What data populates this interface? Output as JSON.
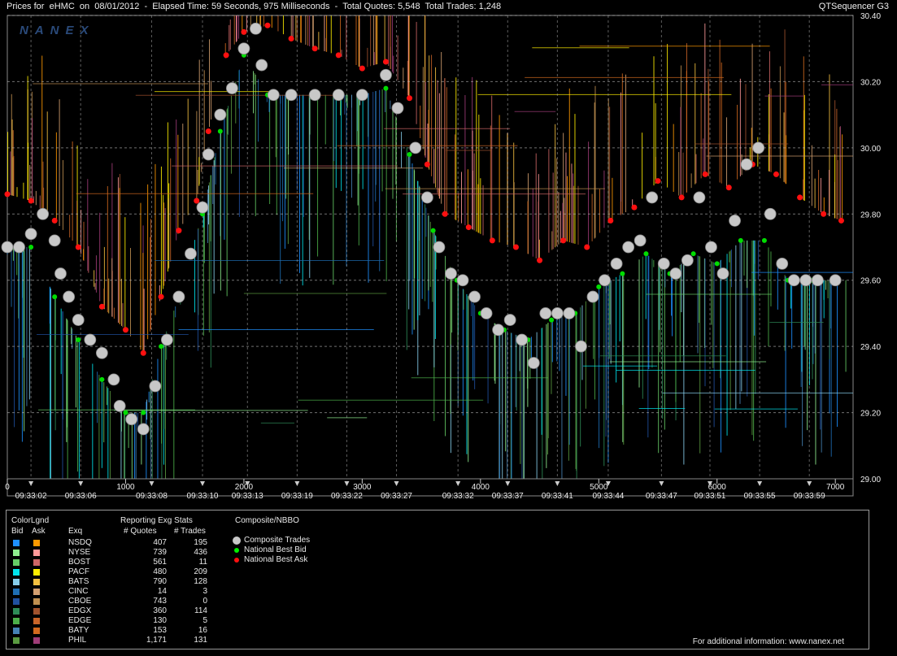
{
  "header": {
    "prefix": "Prices for",
    "symbol": "eHMC",
    "on_label": "on",
    "date": "08/01/2012",
    "elapsed": "Elapsed Time: 59 Seconds, 975 Milliseconds",
    "quotes": "Total Quotes: 5,548",
    "trades": "Total Trades: 1,248",
    "app": "QTSequencer G3"
  },
  "watermark": "NANEX",
  "chart_data": {
    "type": "scatter",
    "title": "Prices for eHMC on 08/01/2012",
    "xlim": [
      0,
      7150
    ],
    "ylim": [
      29.0,
      30.4
    ],
    "y_ticks": [
      "29.00",
      "29.20",
      "29.40",
      "29.60",
      "29.80",
      "30.00",
      "30.20",
      "30.40"
    ],
    "x_ticks": [
      "0",
      "1000",
      "2000",
      "3000",
      "4000",
      "5000",
      "6000",
      "7000"
    ],
    "time_labels": [
      {
        "x": 200,
        "t": "09:33:02"
      },
      {
        "x": 620,
        "t": "09:33:06"
      },
      {
        "x": 1220,
        "t": "09:33:08"
      },
      {
        "x": 1650,
        "t": "09:33:10"
      },
      {
        "x": 2030,
        "t": "09:33:13"
      },
      {
        "x": 2450,
        "t": "09:33:19"
      },
      {
        "x": 2870,
        "t": "09:33:22"
      },
      {
        "x": 3290,
        "t": "09:33:27"
      },
      {
        "x": 3810,
        "t": "09:33:32"
      },
      {
        "x": 4230,
        "t": "09:33:37"
      },
      {
        "x": 4650,
        "t": "09:33:41"
      },
      {
        "x": 5080,
        "t": "09:33:44"
      },
      {
        "x": 5530,
        "t": "09:33:47"
      },
      {
        "x": 5940,
        "t": "09:33:51"
      },
      {
        "x": 6360,
        "t": "09:33:55"
      },
      {
        "x": 6780,
        "t": "09:33:59"
      }
    ],
    "series": [
      {
        "name": "Composite Trades",
        "color": "#c8c8c8",
        "values": [
          [
            0,
            29.7
          ],
          [
            100,
            29.7
          ],
          [
            200,
            29.74
          ],
          [
            300,
            29.8
          ],
          [
            400,
            29.72
          ],
          [
            450,
            29.62
          ],
          [
            520,
            29.55
          ],
          [
            600,
            29.48
          ],
          [
            700,
            29.42
          ],
          [
            800,
            29.38
          ],
          [
            900,
            29.3
          ],
          [
            950,
            29.22
          ],
          [
            1050,
            29.18
          ],
          [
            1150,
            29.15
          ],
          [
            1250,
            29.28
          ],
          [
            1350,
            29.42
          ],
          [
            1450,
            29.55
          ],
          [
            1550,
            29.68
          ],
          [
            1650,
            29.82
          ],
          [
            1700,
            29.98
          ],
          [
            1800,
            30.1
          ],
          [
            1900,
            30.18
          ],
          [
            2000,
            30.3
          ],
          [
            2100,
            30.36
          ],
          [
            2150,
            30.25
          ],
          [
            2250,
            30.16
          ],
          [
            2400,
            30.16
          ],
          [
            2600,
            30.16
          ],
          [
            2800,
            30.16
          ],
          [
            3000,
            30.16
          ],
          [
            3200,
            30.22
          ],
          [
            3300,
            30.12
          ],
          [
            3450,
            30.0
          ],
          [
            3550,
            29.85
          ],
          [
            3650,
            29.7
          ],
          [
            3750,
            29.62
          ],
          [
            3850,
            29.6
          ],
          [
            3950,
            29.55
          ],
          [
            4050,
            29.5
          ],
          [
            4150,
            29.45
          ],
          [
            4250,
            29.48
          ],
          [
            4350,
            29.42
          ],
          [
            4450,
            29.35
          ],
          [
            4550,
            29.5
          ],
          [
            4650,
            29.5
          ],
          [
            4750,
            29.5
          ],
          [
            4850,
            29.4
          ],
          [
            4950,
            29.55
          ],
          [
            5050,
            29.6
          ],
          [
            5150,
            29.65
          ],
          [
            5250,
            29.7
          ],
          [
            5350,
            29.72
          ],
          [
            5450,
            29.85
          ],
          [
            5550,
            29.65
          ],
          [
            5650,
            29.62
          ],
          [
            5750,
            29.66
          ],
          [
            5850,
            29.85
          ],
          [
            5950,
            29.7
          ],
          [
            6050,
            29.62
          ],
          [
            6150,
            29.78
          ],
          [
            6250,
            29.95
          ],
          [
            6350,
            30.0
          ],
          [
            6450,
            29.8
          ],
          [
            6550,
            29.65
          ],
          [
            6650,
            29.6
          ],
          [
            6750,
            29.6
          ],
          [
            6850,
            29.6
          ],
          [
            7000,
            29.6
          ]
        ]
      },
      {
        "name": "National Best Bid",
        "color": "#00dd00",
        "values": [
          [
            0,
            29.7
          ],
          [
            200,
            29.7
          ],
          [
            400,
            29.55
          ],
          [
            600,
            29.42
          ],
          [
            800,
            29.3
          ],
          [
            1000,
            29.2
          ],
          [
            1150,
            29.2
          ],
          [
            1300,
            29.4
          ],
          [
            1450,
            29.55
          ],
          [
            1550,
            29.68
          ],
          [
            1650,
            29.8
          ],
          [
            1800,
            30.05
          ],
          [
            2000,
            30.28
          ],
          [
            2200,
            30.16
          ],
          [
            2600,
            30.16
          ],
          [
            3000,
            30.16
          ],
          [
            3200,
            30.18
          ],
          [
            3400,
            29.98
          ],
          [
            3600,
            29.75
          ],
          [
            3800,
            29.6
          ],
          [
            4000,
            29.5
          ],
          [
            4200,
            29.45
          ],
          [
            4400,
            29.42
          ],
          [
            4600,
            29.48
          ],
          [
            4800,
            29.5
          ],
          [
            5000,
            29.58
          ],
          [
            5200,
            29.62
          ],
          [
            5400,
            29.68
          ],
          [
            5600,
            29.62
          ],
          [
            5800,
            29.68
          ],
          [
            6000,
            29.65
          ],
          [
            6200,
            29.72
          ],
          [
            6400,
            29.72
          ],
          [
            6600,
            29.6
          ],
          [
            6800,
            29.6
          ],
          [
            7000,
            29.6
          ]
        ]
      },
      {
        "name": "National Best Ask",
        "color": "#ff1010",
        "values": [
          [
            0,
            29.86
          ],
          [
            200,
            29.84
          ],
          [
            400,
            29.78
          ],
          [
            600,
            29.7
          ],
          [
            800,
            29.52
          ],
          [
            1000,
            29.45
          ],
          [
            1150,
            29.38
          ],
          [
            1300,
            29.55
          ],
          [
            1450,
            29.75
          ],
          [
            1600,
            29.84
          ],
          [
            1700,
            30.05
          ],
          [
            1850,
            30.28
          ],
          [
            2000,
            30.35
          ],
          [
            2200,
            30.37
          ],
          [
            2400,
            30.33
          ],
          [
            2600,
            30.3
          ],
          [
            2800,
            30.28
          ],
          [
            3000,
            30.24
          ],
          [
            3200,
            30.26
          ],
          [
            3400,
            30.15
          ],
          [
            3550,
            29.95
          ],
          [
            3700,
            29.8
          ],
          [
            3900,
            29.76
          ],
          [
            4100,
            29.72
          ],
          [
            4300,
            29.7
          ],
          [
            4500,
            29.66
          ],
          [
            4700,
            29.72
          ],
          [
            4900,
            29.7
          ],
          [
            5100,
            29.78
          ],
          [
            5300,
            29.82
          ],
          [
            5500,
            29.9
          ],
          [
            5700,
            29.85
          ],
          [
            5900,
            29.92
          ],
          [
            6100,
            29.88
          ],
          [
            6300,
            29.95
          ],
          [
            6500,
            29.92
          ],
          [
            6700,
            29.85
          ],
          [
            6900,
            29.8
          ],
          [
            7050,
            29.78
          ]
        ]
      }
    ]
  },
  "legend": {
    "color_title": "ColorLgnd",
    "bid": "Bid",
    "ask": "Ask",
    "stats_title": "Reporting Exg Stats",
    "exq": "Exq",
    "quotes_hdr": "# Quotes",
    "trades_hdr": "# Trades",
    "nbbo_title": "Composite/NBBO",
    "composite": "Composite Trades",
    "nbb": "National Best Bid",
    "nba": "National Best Ask",
    "composite_color": "#c8c8c8",
    "nbb_color": "#00ee00",
    "nba_color": "#ff1010",
    "rows": [
      {
        "exq": "NSDQ",
        "quotes": "407",
        "trades": "195",
        "bid": "#1e90ff",
        "ask": "#ff9900"
      },
      {
        "exq": "NYSE",
        "quotes": "739",
        "trades": "436",
        "bid": "#90ee90",
        "ask": "#ff9999"
      },
      {
        "exq": "BOST",
        "quotes": "561",
        "trades": "11",
        "bid": "#66cc66",
        "ask": "#cc6666"
      },
      {
        "exq": "PACF",
        "quotes": "480",
        "trades": "209",
        "bid": "#00e5ee",
        "ask": "#ffee00"
      },
      {
        "exq": "BATS",
        "quotes": "790",
        "trades": "128",
        "bid": "#87ceeb",
        "ask": "#f4c040"
      },
      {
        "exq": "CINC",
        "quotes": "14",
        "trades": "3",
        "bid": "#1e6eb4",
        "ask": "#d4a070"
      },
      {
        "exq": "CBOE",
        "quotes": "743",
        "trades": "0",
        "bid": "#2050a0",
        "ask": "#c09050"
      },
      {
        "exq": "EDGX",
        "quotes": "360",
        "trades": "114",
        "bid": "#2e8b57",
        "ask": "#a0522d"
      },
      {
        "exq": "EDGE",
        "quotes": "130",
        "trades": "5",
        "bid": "#4daf4a",
        "ask": "#c86428"
      },
      {
        "exq": "BATY",
        "quotes": "153",
        "trades": "16",
        "bid": "#4682b4",
        "ask": "#d2691e"
      },
      {
        "exq": "PHIL",
        "quotes": "1,171",
        "trades": "131",
        "bid": "#5a9a40",
        "ask": "#a03c78"
      }
    ]
  },
  "footer": "For additional information: www.nanex.net"
}
